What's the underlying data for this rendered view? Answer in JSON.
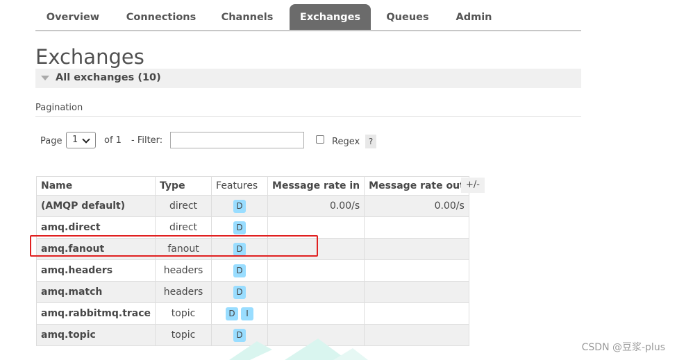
{
  "nav": {
    "tabs": [
      {
        "label": "Overview",
        "active": false
      },
      {
        "label": "Connections",
        "active": false
      },
      {
        "label": "Channels",
        "active": false
      },
      {
        "label": "Exchanges",
        "active": true
      },
      {
        "label": "Queues",
        "active": false
      },
      {
        "label": "Admin",
        "active": false
      }
    ]
  },
  "page": {
    "title": "Exchanges",
    "section_label": "All exchanges (10)"
  },
  "pagination": {
    "heading": "Pagination",
    "page_label": "Page",
    "page_value": "1",
    "of_label": "of 1",
    "filter_label": "- Filter:",
    "filter_value": "",
    "regex_label": "Regex",
    "regex_checked": false,
    "help": "?"
  },
  "table": {
    "headers": [
      "Name",
      "Type",
      "Features",
      "Message rate in",
      "Message rate out"
    ],
    "toggle_columns": "+/-",
    "rows": [
      {
        "name": "(AMQP default)",
        "type": "direct",
        "features": [
          "D"
        ],
        "rate_in": "0.00/s",
        "rate_out": "0.00/s"
      },
      {
        "name": "amq.direct",
        "type": "direct",
        "features": [
          "D"
        ],
        "rate_in": "",
        "rate_out": ""
      },
      {
        "name": "amq.fanout",
        "type": "fanout",
        "features": [
          "D"
        ],
        "rate_in": "",
        "rate_out": "",
        "highlighted": true
      },
      {
        "name": "amq.headers",
        "type": "headers",
        "features": [
          "D"
        ],
        "rate_in": "",
        "rate_out": ""
      },
      {
        "name": "amq.match",
        "type": "headers",
        "features": [
          "D"
        ],
        "rate_in": "",
        "rate_out": ""
      },
      {
        "name": "amq.rabbitmq.trace",
        "type": "topic",
        "features": [
          "D",
          "I"
        ],
        "rate_in": "",
        "rate_out": ""
      },
      {
        "name": "amq.topic",
        "type": "topic",
        "features": [
          "D"
        ],
        "rate_in": "",
        "rate_out": ""
      }
    ]
  },
  "watermark": "CSDN @豆浆-plus",
  "colors": {
    "active_tab_bg": "#6b6b6b",
    "feature_badge": "#99ddff",
    "highlight_border": "#e02020",
    "row_alt": "#f0f0f0"
  }
}
